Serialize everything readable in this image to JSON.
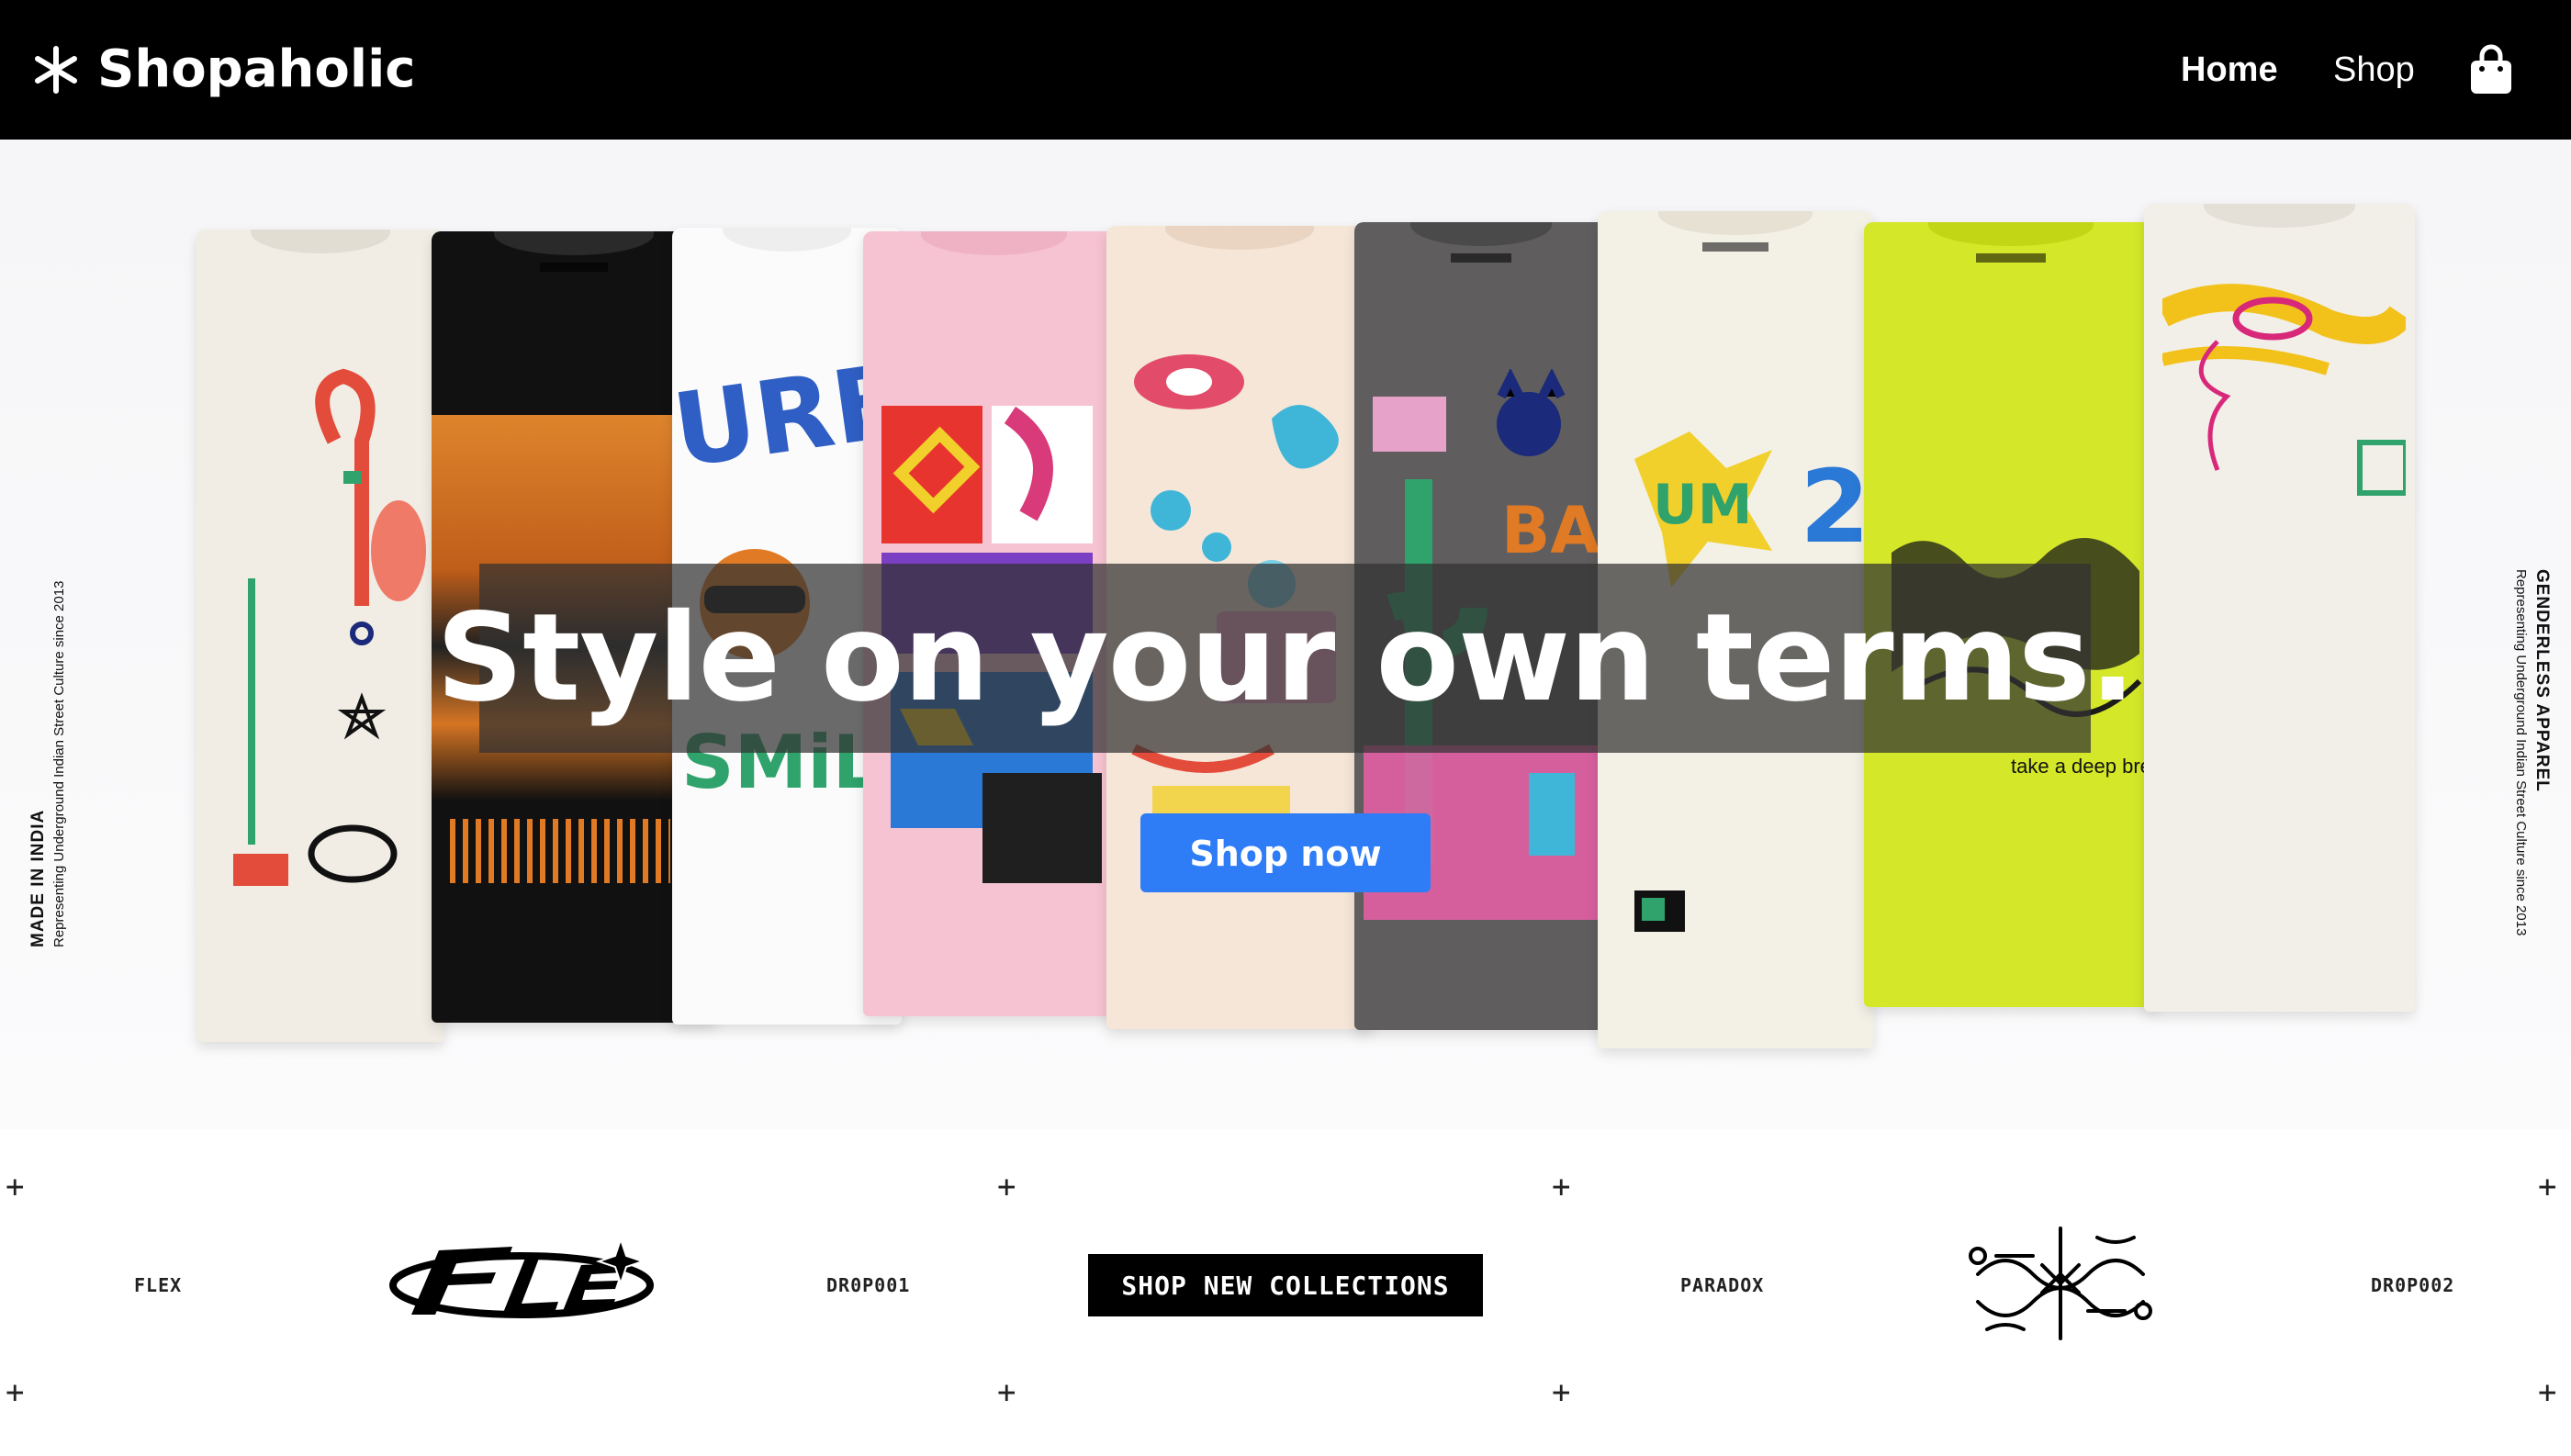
{
  "header": {
    "brand_name": "Shopaholic",
    "brand_icon": "asterisk-icon",
    "nav": [
      {
        "label": "Home",
        "active": true
      },
      {
        "label": "Shop",
        "active": false
      }
    ],
    "cart_icon": "shopping-bag-icon"
  },
  "hero": {
    "headline": "Style on your own terms.",
    "cta_label": "Shop now",
    "side_left": {
      "title": "MADE IN INDIA",
      "subtitle": "Representing  Underground Indian Street Culture since 2013"
    },
    "side_right": {
      "title": "GENDERLESS APPAREL",
      "subtitle": "Representing  Underground Indian Street Culture since 2013"
    },
    "shirt_art_text": {
      "urban": "URBAN",
      "smiley": "SMiLEY",
      "bang": "BANG",
      "um": "UM",
      "breath": "take a deep breath."
    }
  },
  "collections": {
    "left_name": "FLEX",
    "left_drop": "DR0P001",
    "button_label": "SHOP NEW COLLECTIONS",
    "right_name": "PARADOX",
    "right_drop": "DR0P002"
  },
  "colors": {
    "header_bg": "#000000",
    "cta_blue": "#2e7cf6",
    "headline_band": "rgba(50,50,50,0.72)",
    "strip_button_bg": "#000000"
  }
}
